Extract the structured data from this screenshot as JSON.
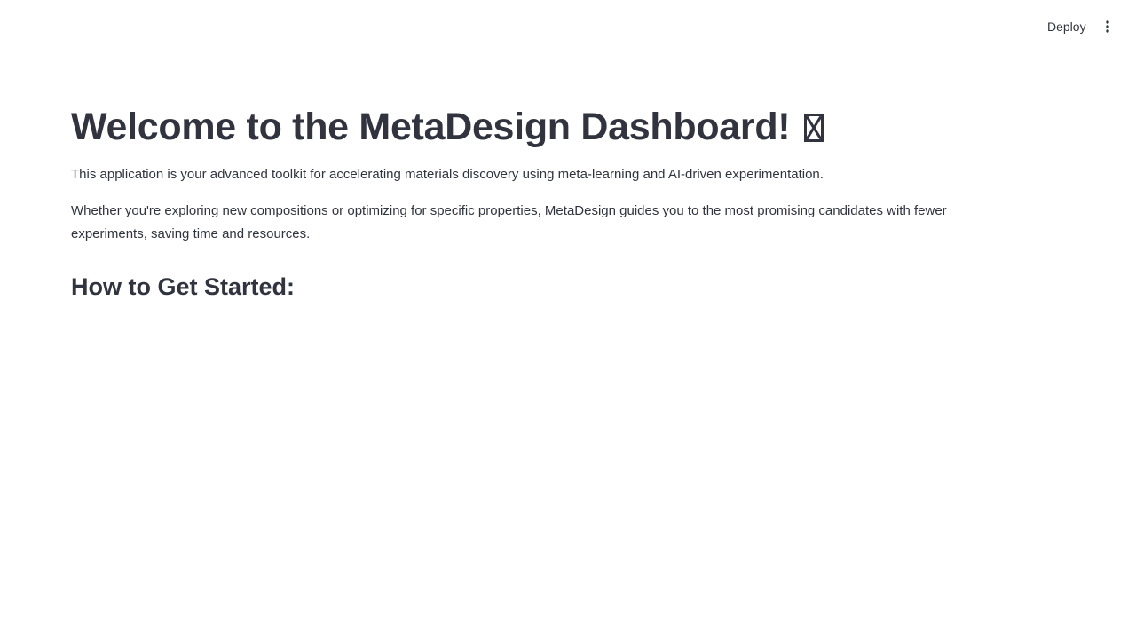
{
  "header": {
    "deploy_label": "Deploy",
    "menu_icon": "more-vertical-icon"
  },
  "main": {
    "title": "Welcome to the MetaDesign Dashboard!",
    "title_emoji_icon": "missing-glyph-icon",
    "paragraph_1": "This application is your advanced toolkit for accelerating materials discovery using meta-learning and AI-driven experimentation.",
    "paragraph_2": "Whether you're exploring new compositions or optimizing for specific properties, MetaDesign guides you to the most promising candidates with fewer experiments, saving time and resources.",
    "section_heading": "How to Get Started:"
  }
}
